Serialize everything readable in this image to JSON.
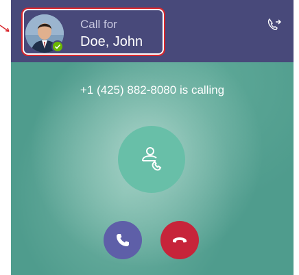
{
  "caller_card": {
    "label": "Call for",
    "name": "Doe, John",
    "presence": "available"
  },
  "call": {
    "status_text": "+1 (425) 882-8080 is calling"
  },
  "icons": {
    "header_right": "call-transfer-icon",
    "center": "call-park-icon",
    "accept": "phone-icon",
    "decline": "hang-up-icon",
    "presence": "check-icon"
  },
  "colors": {
    "header_bg": "#48497a",
    "panel_bg": "#4f9c8d",
    "highlight_border": "#d9262c",
    "accept_bg": "#5e5fa8",
    "decline_bg": "#c7243a",
    "center_button_bg": "#68bfa8",
    "presence_green": "#6bb700"
  }
}
